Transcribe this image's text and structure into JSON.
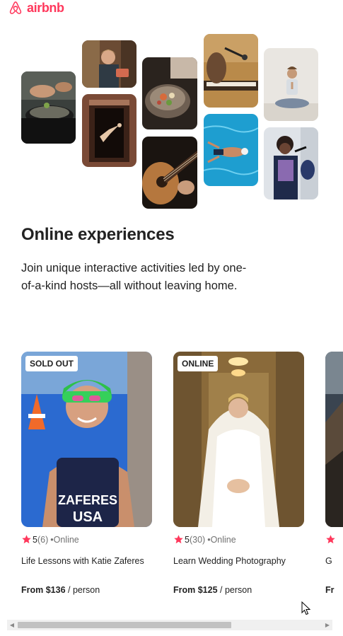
{
  "brand": {
    "name": "airbnb",
    "color": "#FF385C"
  },
  "hero": {
    "title": "Online experiences",
    "description": "Join unique interactive activities led by one-of-a-kind hosts—all without leaving home."
  },
  "collage": [
    {
      "subject": "cooking-pan"
    },
    {
      "subject": "smiling-host"
    },
    {
      "subject": "dancer-doorway"
    },
    {
      "subject": "food-bowl"
    },
    {
      "subject": "guitar"
    },
    {
      "subject": "piano-singer"
    },
    {
      "subject": "swimmer-pool"
    },
    {
      "subject": "meditation"
    },
    {
      "subject": "singer-microphone"
    }
  ],
  "cards": [
    {
      "badge": "SOLD OUT",
      "rating": "5",
      "reviews": "(6)",
      "mode": "•Online",
      "title": "Life Lessons with Katie Zaferes",
      "price_from": "From $136",
      "price_unit": " / person",
      "shirt_text_1": "ZAFERES",
      "shirt_text_2": "USA"
    },
    {
      "badge": "ONLINE",
      "rating": "5",
      "reviews": "(30)",
      "mode": "•Online",
      "title": "Learn Wedding Photography",
      "price_from": "From $125",
      "price_unit": " / person"
    },
    {
      "title": "G",
      "price_from": "Fr"
    }
  ],
  "scrollbar": {
    "left_arrow": "◀",
    "right_arrow": "▶"
  },
  "icons": {
    "logo": "airbnb-logo-icon",
    "star": "star-icon",
    "cursor": "mouse-cursor-icon"
  }
}
